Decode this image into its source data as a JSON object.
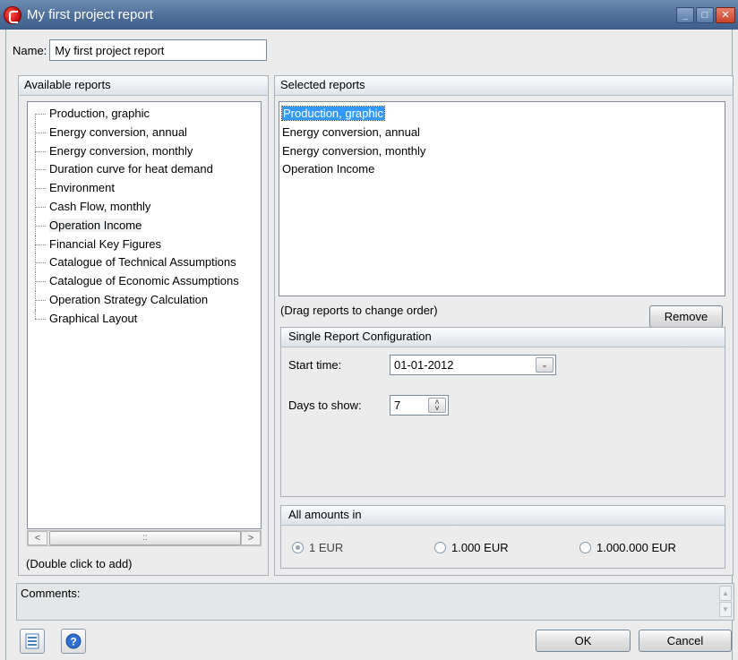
{
  "window": {
    "title": "My first project report",
    "controls": [
      "minimize",
      "maximize",
      "close"
    ]
  },
  "name": {
    "label": "Name:",
    "value": "My first project report"
  },
  "available": {
    "header": "Available reports",
    "items": [
      "Production, graphic",
      "Energy conversion, annual",
      "Energy conversion, monthly",
      "Duration curve for heat demand",
      "Environment",
      "Cash Flow, monthly",
      "Operation Income",
      "Financial Key Figures",
      "Catalogue of Technical Assumptions",
      "Catalogue of Economic Assumptions",
      "Operation Strategy Calculation",
      "Graphical Layout"
    ],
    "hovered_item": "Operation Income",
    "hint": "(Double click to add)",
    "scroll_left": "<",
    "scroll_right": ">",
    "scroll_grip": "::"
  },
  "selected": {
    "header": "Selected reports",
    "items": [
      "Production, graphic",
      "Energy conversion, annual",
      "Energy conversion, monthly",
      "Operation Income"
    ],
    "selected_item": "Production, graphic",
    "hint": "(Drag reports to change order)",
    "remove_label": "Remove"
  },
  "config": {
    "header": "Single Report Configuration",
    "start_time_label": "Start time:",
    "start_time_value": "01-01-2012",
    "days_label": "Days to show:",
    "days_value": "7"
  },
  "amounts": {
    "header": "All amounts in",
    "options": [
      "1 EUR",
      "1.000 EUR",
      "1.000.000 EUR"
    ],
    "selected": "1 EUR"
  },
  "comments": {
    "label": "Comments:"
  },
  "footer": {
    "ok_label": "OK",
    "cancel_label": "Cancel",
    "icons": [
      "report-list-icon",
      "help-icon"
    ]
  },
  "colors": {
    "titlebar": "#4f6f9a",
    "selection": "#3399ff",
    "help_icon": "#2f6fd1"
  }
}
